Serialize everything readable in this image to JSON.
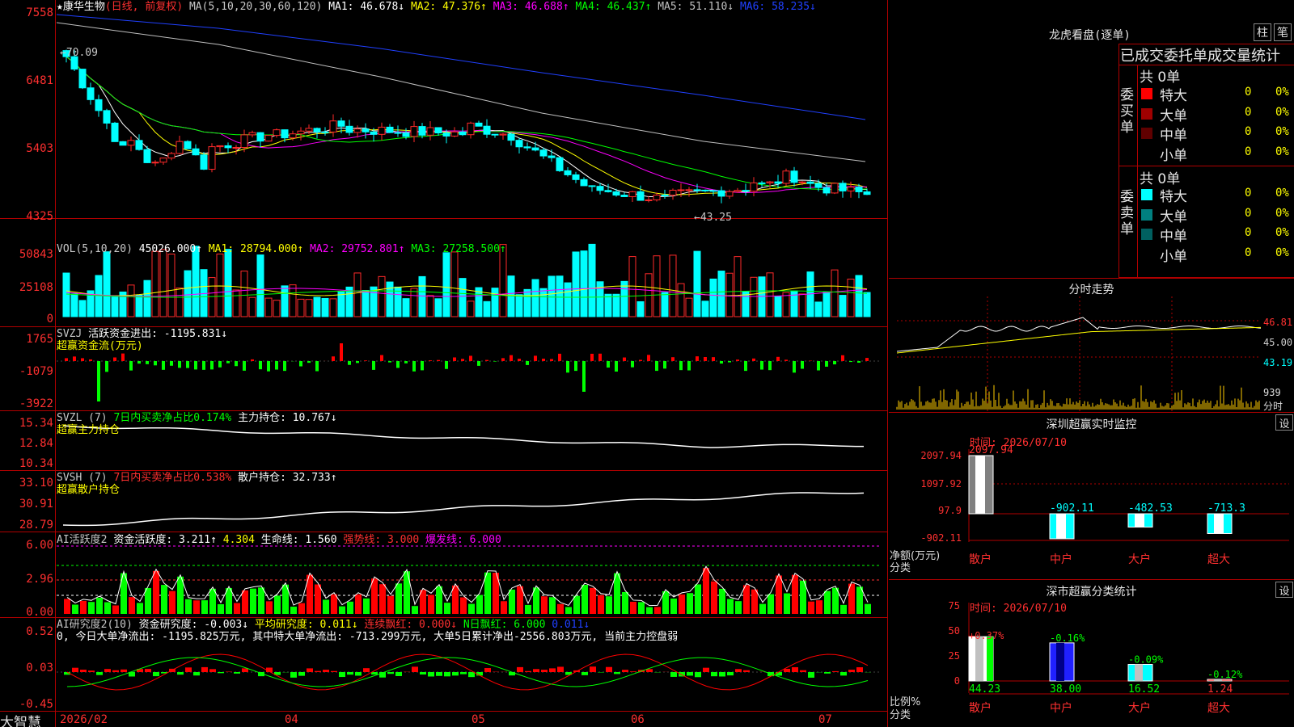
{
  "colors": {
    "up": "#ff2a2a",
    "down": "#00ffff",
    "ma1": "#ffffff",
    "ma2": "#ffff00",
    "ma3": "#ff00ff",
    "ma4": "#00ff00",
    "ma5": "#c0c0c0",
    "ma6": "#2040ff",
    "green": "#00ff00",
    "red": "#ff0000"
  },
  "stock": {
    "icon": "star-icon",
    "star": "★",
    "name": "康华生物",
    "mode": "(日线, 前复权)"
  },
  "ma_header": {
    "label": "MA(5,10,20,30,60,120)",
    "ma1": "MA1: 46.678↓",
    "ma2": "MA2: 47.376↑",
    "ma3": "MA3: 46.688↑",
    "ma4": "MA4: 46.437↑",
    "ma5": "MA5: 51.110↓",
    "ma6": "MA6: 58.235↓"
  },
  "price_axis": [
    "7558",
    "6481",
    "5403",
    "4325"
  ],
  "price_marks": {
    "high": "70.09",
    "low": "←43.25"
  },
  "vol": {
    "header": "VOL(5,10,20)",
    "val": "45026.000↑",
    "ma1": "MA1: 28794.000↑",
    "ma2": "MA2: 29752.801↑",
    "ma3": "MA3: 27258.500↑",
    "axis": [
      "50843",
      "25108",
      "0"
    ]
  },
  "svzj": {
    "title": "SVZJ",
    "label": "活跃资金进出: -1195.831↓",
    "sub": "超赢资金流(万元)",
    "axis": [
      "1765",
      "-1079",
      "-3922"
    ]
  },
  "svzl": {
    "title": "SVZL (7)",
    "mid": "7日内买卖净占比0.174%",
    "right": "主力持仓: 10.767↓",
    "sub": "超赢主力持仓",
    "axis": [
      "15.34",
      "12.84",
      "10.34"
    ]
  },
  "svsh": {
    "title": "SVSH (7)",
    "mid": "7日内买卖净占比0.538%",
    "right": "散户持仓: 32.733↑",
    "sub": "超赢散户持仓",
    "axis": [
      "33.10",
      "30.91",
      "28.79"
    ]
  },
  "ai1": {
    "title": "AI活跃度2",
    "a": "资金活跃度: 3.211↑",
    "b": "4.304",
    "c": "生命线: 1.560",
    "d": "强势线: 3.000",
    "e": "爆发线: 6.000",
    "axis": [
      "6.00",
      "2.96",
      "0.00"
    ]
  },
  "ai2": {
    "title": "AI研究度2(10)",
    "a": "资金研究度: -0.003↓",
    "b": "平均研究度: 0.011↓",
    "c": "连续飘红: 0.000↓",
    "d": "N日飘红: 6.000",
    "e": "0.011↓",
    "note": "0, 今日大单净流出: -1195.825万元, 其中特大单净流出: -713.299万元, 大单5日累计净出-2556.803万元, 当前主力控盘弱",
    "axis": [
      "0.52",
      "0.03",
      "-0.45"
    ]
  },
  "date_axis": [
    "2026/02",
    "04",
    "05",
    "06",
    "07"
  ],
  "brand": "大智慧",
  "longhu": {
    "title": "龙虎看盘(逐单)",
    "btn1": "柱",
    "btn2": "笔",
    "header": "已成交委托单成交量统计",
    "buy_label": "委买单",
    "sell_label": "委卖单",
    "buy_total": "共 0单",
    "sell_total": "共 0单",
    "buy": [
      {
        "name": "特大",
        "count": "0",
        "pct": "0%",
        "color": "#ff0000"
      },
      {
        "name": "大单",
        "count": "0",
        "pct": "0%",
        "color": "#a00000"
      },
      {
        "name": "中单",
        "count": "0",
        "pct": "0%",
        "color": "#600000"
      },
      {
        "name": "小单",
        "count": "0",
        "pct": "0%",
        "color": ""
      }
    ],
    "sell": [
      {
        "name": "特大",
        "count": "0",
        "pct": "0%",
        "color": "#00ffff"
      },
      {
        "name": "大单",
        "count": "0",
        "pct": "0%",
        "color": "#008080"
      },
      {
        "name": "中单",
        "count": "0",
        "pct": "0%",
        "color": "#006060"
      },
      {
        "name": "小单",
        "count": "0",
        "pct": "0%",
        "color": ""
      }
    ]
  },
  "fenshi": {
    "title": "分时走势",
    "axis": [
      "46.81",
      "45.00",
      "43.19"
    ],
    "vol": "939",
    "tag": "分时"
  },
  "sz_monitor": {
    "title": "深圳超赢实时监控",
    "btn": "设",
    "time": "时间: 2026/07/10",
    "axis": [
      "2097.94",
      "1097.92",
      "97.9",
      "-902.11"
    ],
    "ylabel": "净额(万元)",
    "xlabel": "分类",
    "cats": [
      "散户",
      "中户",
      "大户",
      "超大"
    ],
    "values": [
      2097.94,
      -902.11,
      -482.53,
      -713.3
    ],
    "labels": [
      "2097.94",
      "-902.11",
      "-482.53",
      "-713.3"
    ]
  },
  "class_stats": {
    "title": "深市超赢分类统计",
    "btn": "设",
    "time": "时间: 2026/07/10",
    "axis": [
      "75",
      "50",
      "25",
      "0"
    ],
    "ylabel": "比例%",
    "xlabel": "分类",
    "cats": [
      "散户",
      "中户",
      "大户",
      "超大"
    ],
    "values": [
      44.23,
      38.0,
      16.52,
      1.24
    ],
    "chg": [
      "+0.37%",
      "-0.16%",
      "-0.09%",
      "-0.12%"
    ],
    "labels": [
      "44.23",
      "38.00",
      "16.52",
      "1.24"
    ]
  }
}
